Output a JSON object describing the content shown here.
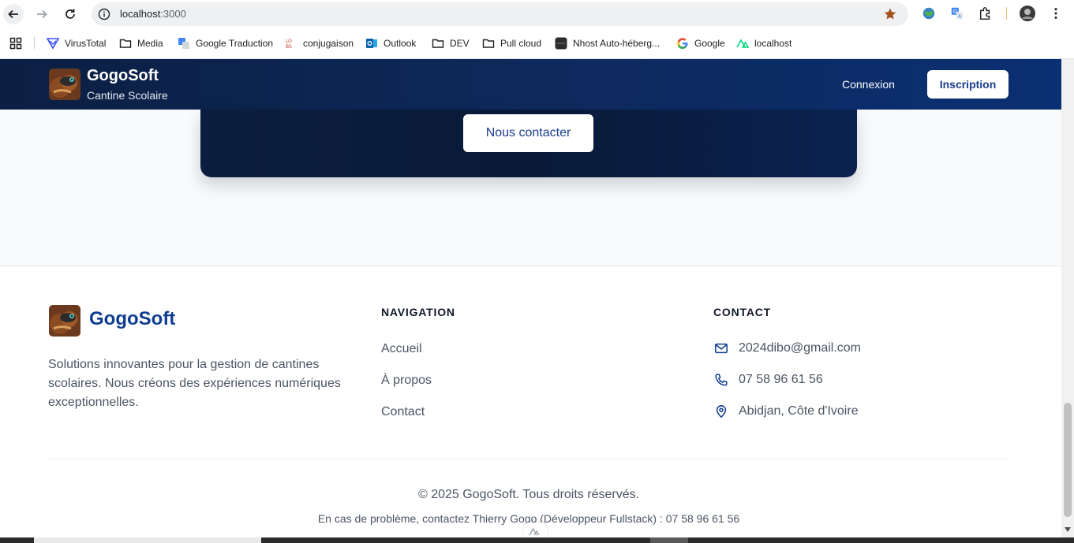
{
  "browser": {
    "url_host": "localhost",
    "url_port": ":3000",
    "bookmarks": [
      {
        "label": "VirusTotal",
        "icon": "virustotal-icon"
      },
      {
        "label": "Media",
        "icon": "folder-icon"
      },
      {
        "label": "Google Traduction",
        "icon": "translate-icon"
      },
      {
        "label": "conjugaison",
        "icon": "conjugaison-icon"
      },
      {
        "label": "Outlook",
        "icon": "outlook-icon"
      },
      {
        "label": "DEV",
        "icon": "folder-icon"
      },
      {
        "label": "Pull cloud",
        "icon": "folder-icon"
      },
      {
        "label": "Nhost Auto-héberg...",
        "icon": "nhost-icon"
      },
      {
        "label": "Google",
        "icon": "google-icon"
      },
      {
        "label": "localhost",
        "icon": "nuxt-icon"
      }
    ]
  },
  "header": {
    "brand_name": "GogoSoft",
    "brand_subtitle": "Cantine Scolaire",
    "login_label": "Connexion",
    "signup_label": "Inscription"
  },
  "cta": {
    "contact_button": "Nous contacter"
  },
  "footer": {
    "brand_name": "GogoSoft",
    "description": "Solutions innovantes pour la gestion de cantines scolaires. Nous créons des expériences numériques exceptionnelles.",
    "navigation_title": "NAVIGATION",
    "navigation_links": [
      "Accueil",
      "À propos",
      "Contact"
    ],
    "contact_title": "CONTACT",
    "contact_items": [
      {
        "icon": "mail-icon",
        "text": "2024dibo@gmail.com"
      },
      {
        "icon": "phone-icon",
        "text": "07 58 96 61 56"
      },
      {
        "icon": "location-icon",
        "text": "Abidjan, Côte d'Ivoire"
      }
    ],
    "copyright": "© 2025 GogoSoft. Tous droits réservés.",
    "support": "En cas de problème, contactez Thierry Gogo (Développeur Fullstack) : 07 58 96 61 56"
  },
  "colors": {
    "header_dark": "#0b1f42",
    "brand_blue": "#0f3d91",
    "accent_green": "#00dc82"
  }
}
